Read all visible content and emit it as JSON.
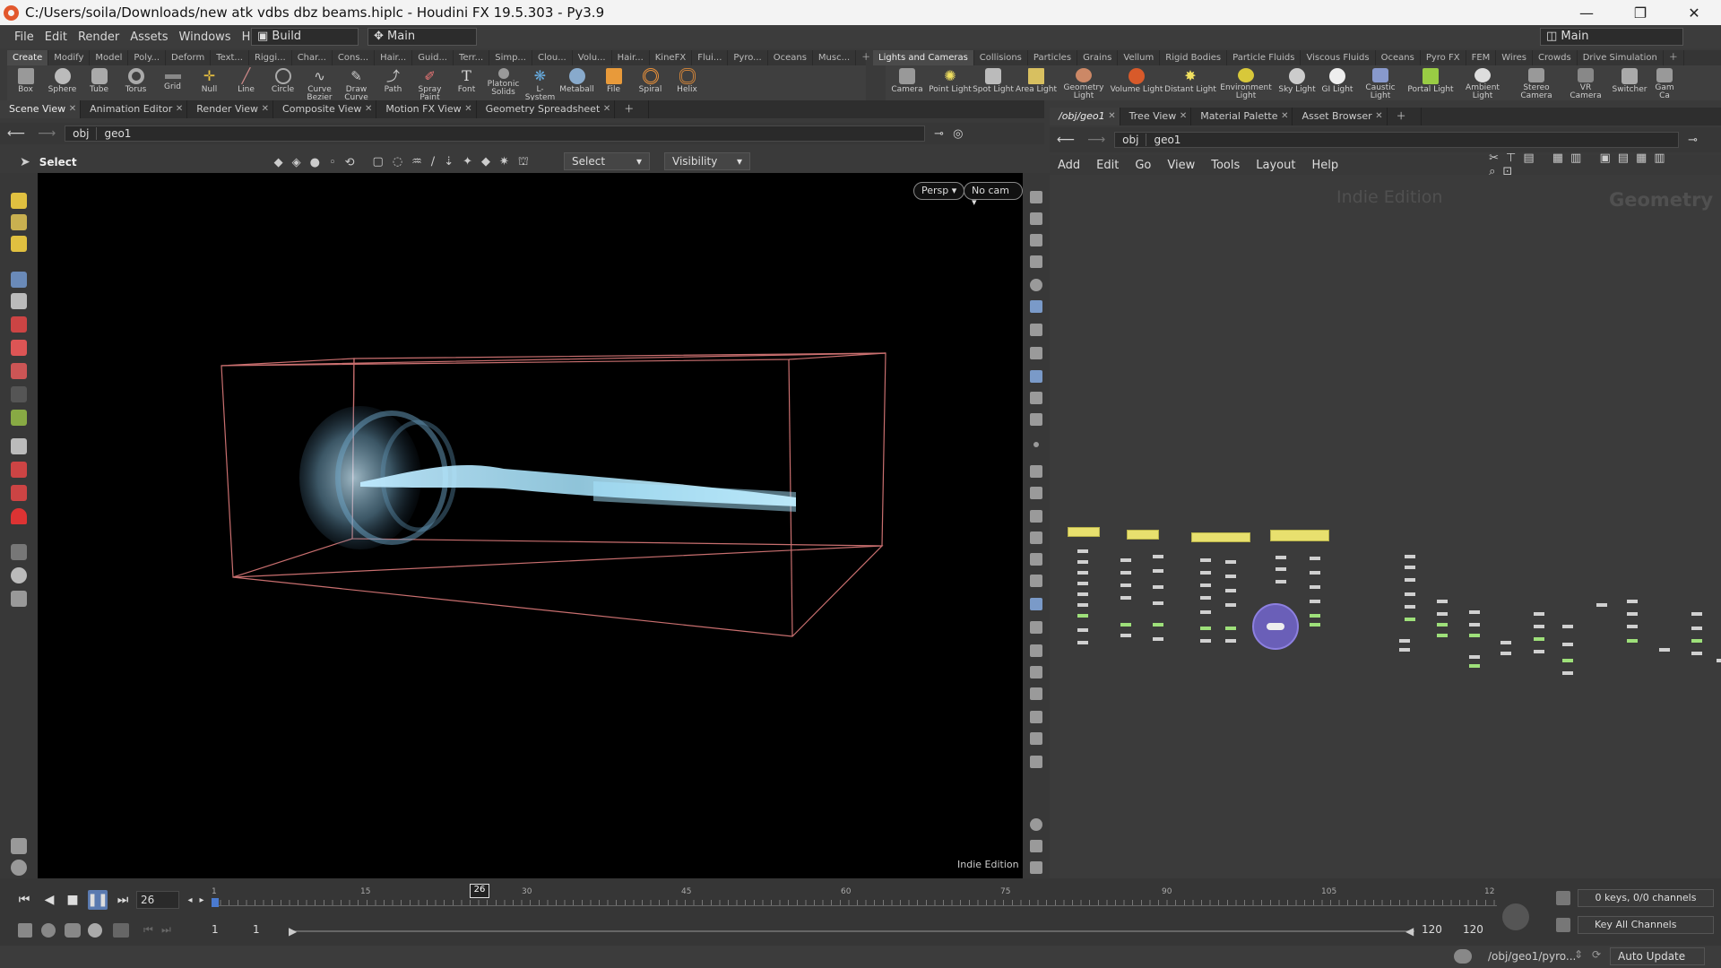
{
  "window": {
    "title": "C:/Users/soila/Downloads/new atk vdbs dbz beams.hiplc - Houdini FX 19.5.303 - Py3.9",
    "buttons": [
      "—",
      "❐",
      "✕"
    ]
  },
  "menubar": {
    "items": [
      "File",
      "Edit",
      "Render",
      "Assets",
      "Windows",
      "Help"
    ],
    "desktop": "Build",
    "layout": "Main",
    "right_desktop": "Main"
  },
  "shelf_left": {
    "tabs": [
      "Create",
      "Modify",
      "Model",
      "Poly...",
      "Deform",
      "Text...",
      "Riggi...",
      "Char...",
      "Cons...",
      "Hair...",
      "Guid...",
      "Terr...",
      "Simp...",
      "Clou...",
      "Volu...",
      "Hair...",
      "KineFX",
      "Flui...",
      "Pyro...",
      "Oceans",
      "Musc..."
    ],
    "tools": [
      "Box",
      "Sphere",
      "Tube",
      "Torus",
      "Grid",
      "Null",
      "Line",
      "Circle",
      "Curve Bezier",
      "Draw Curve",
      "Path",
      "Spray Paint",
      "Font",
      "Platonic Solids",
      "L-System",
      "Metaball",
      "File",
      "Spiral",
      "Helix"
    ]
  },
  "shelf_right": {
    "tabs": [
      "Lights and Cameras",
      "Collisions",
      "Particles",
      "Grains",
      "Vellum",
      "Rigid Bodies",
      "Particle Fluids",
      "Viscous Fluids",
      "Oceans",
      "Pyro FX",
      "FEM",
      "Wires",
      "Crowds",
      "Drive Simulation"
    ],
    "tools": [
      "Camera",
      "Point Light",
      "Spot Light",
      "Area Light",
      "Geometry Light",
      "Volume Light",
      "Distant Light",
      "Environment Light",
      "Sky Light",
      "GI Light",
      "Caustic Light",
      "Portal Light",
      "Ambient Light",
      "Stereo Camera",
      "VR Camera",
      "Switcher",
      "Gam Ca"
    ]
  },
  "left_pane": {
    "tabs": [
      "Scene View",
      "Animation Editor",
      "Render View",
      "Composite View",
      "Motion FX View",
      "Geometry Spreadsheet"
    ],
    "path": [
      "obj",
      "geo1"
    ],
    "tool_label": "Select",
    "select_mode": "Select",
    "visibility": "Visibility",
    "persp": "Persp",
    "cam": "No cam",
    "watermark": "Indie Edition"
  },
  "right_pane": {
    "tabs": [
      "/obj/geo1",
      "Tree View",
      "Material Palette",
      "Asset Browser"
    ],
    "path": [
      "obj",
      "geo1"
    ],
    "menu": [
      "Add",
      "Edit",
      "Go",
      "View",
      "Tools",
      "Layout",
      "Help"
    ],
    "watermark": "Indie Edition",
    "context": "Geometry"
  },
  "timeline": {
    "frame": "26",
    "marker": "26",
    "ticks": [
      "1",
      "15",
      "30",
      "45",
      "60",
      "75",
      "90",
      "105",
      "12"
    ],
    "start": "1",
    "start2": "1",
    "end": "120",
    "end2": "120",
    "keys": "0 keys, 0/0 channels",
    "key_mode": "Key All Channels"
  },
  "status": {
    "path": "/obj/geo1/pyro...",
    "update": "Auto Update"
  },
  "colors": {
    "beam": "#a8e6ff",
    "bbox": "#c96f6f",
    "node": "#e8e06e",
    "accent": "#e2572c"
  }
}
